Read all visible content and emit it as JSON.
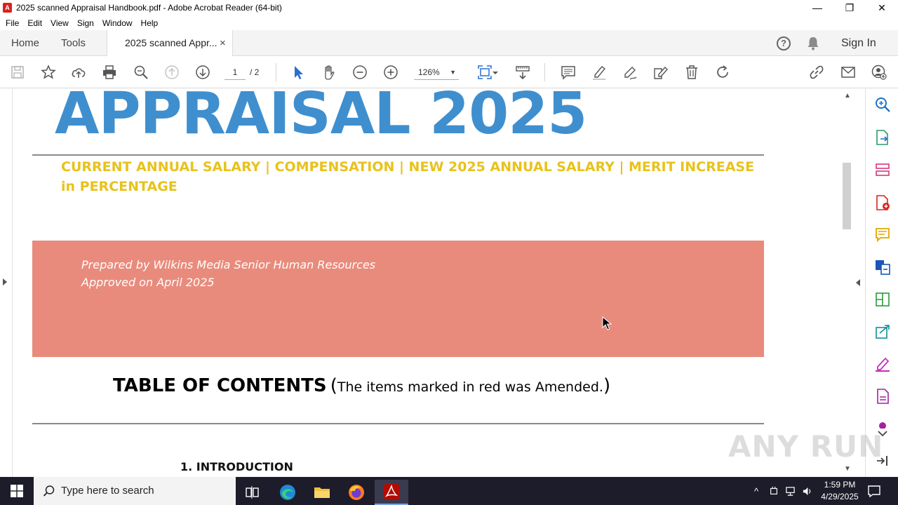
{
  "window": {
    "title": "2025 scanned Appraisal Handbook.pdf - Adobe Acrobat Reader (64-bit)",
    "controls": {
      "minimize": "—",
      "maximize": "❐",
      "close": "✕"
    }
  },
  "menu": {
    "items": [
      "File",
      "Edit",
      "View",
      "Sign",
      "Window",
      "Help"
    ]
  },
  "tabs": {
    "home": "Home",
    "tools": "Tools",
    "document_tab": "2025 scanned Appr...",
    "close": "×",
    "sign_in": "Sign In",
    "help": "?"
  },
  "toolbar": {
    "current_page": "1",
    "total_pages": "/ 2",
    "zoom": "126%",
    "zoom_caret": "▼"
  },
  "document": {
    "title": "APPRAISAL 2025",
    "subtitle": "CURRENT ANNUAL SALARY | COMPENSATION | NEW 2025 ANNUAL SALARY | MERIT INCREASE in PERCENTAGE",
    "prepared_by": "Prepared by Wilkins Media Senior Human Resources",
    "approved": "Approved on April 2025",
    "toc_title": "TABLE OF CONTENTS",
    "toc_open": "(",
    "toc_note": "The items marked in red was Amended.",
    "toc_close": ")",
    "toc_items": [
      "1. INTRODUCTION"
    ]
  },
  "scrollbar": {
    "up": "▲",
    "down": "▼"
  },
  "watermark": "ANY RUN",
  "taskbar": {
    "search_placeholder": "Type here to search",
    "time": "1:59 PM",
    "date": "4/29/2025",
    "tray_chevron": "^"
  },
  "colors": {
    "title_blue": "#3f8fcf",
    "subtitle_yellow": "#e8c21c",
    "banner_salmon": "#e98b7c",
    "acrobat_red": "#d9231d"
  }
}
